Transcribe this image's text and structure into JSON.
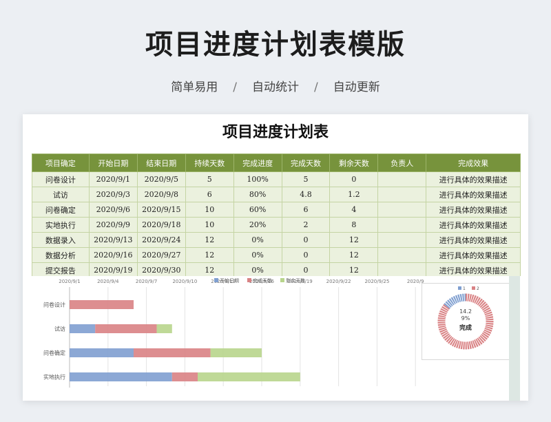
{
  "page": {
    "title": "项目进度计划表模版",
    "subtitle": [
      "简单易用",
      "/",
      "自动统计",
      "/",
      "自动更新"
    ]
  },
  "sheet": {
    "title": "项目进度计划表",
    "headers": [
      "项目确定",
      "开始日期",
      "结束日期",
      "持续天数",
      "完成进度",
      "完成天数",
      "剩余天数",
      "负责人",
      "完成效果"
    ],
    "rows": [
      [
        "问卷设计",
        "2020/9/1",
        "2020/9/5",
        "5",
        "100%",
        "5",
        "0",
        "",
        "进行具体的效果描述"
      ],
      [
        "试访",
        "2020/9/3",
        "2020/9/8",
        "6",
        "80%",
        "4.8",
        "1.2",
        "",
        "进行具体的效果描述"
      ],
      [
        "问卷确定",
        "2020/9/6",
        "2020/9/15",
        "10",
        "60%",
        "6",
        "4",
        "",
        "进行具体的效果描述"
      ],
      [
        "实地执行",
        "2020/9/9",
        "2020/9/18",
        "10",
        "20%",
        "2",
        "8",
        "",
        "进行具体的效果描述"
      ],
      [
        "数据录入",
        "2020/9/13",
        "2020/9/24",
        "12",
        "0%",
        "0",
        "12",
        "",
        "进行具体的效果描述"
      ],
      [
        "数据分析",
        "2020/9/16",
        "2020/9/27",
        "12",
        "0%",
        "0",
        "12",
        "",
        "进行具体的效果描述"
      ],
      [
        "提交报告",
        "2020/9/19",
        "2020/9/30",
        "12",
        "0%",
        "0",
        "12",
        "",
        "进行具体的效果描述"
      ]
    ]
  },
  "colors": {
    "header_green": "#77933c",
    "row_green": "#ebf1de",
    "series_start": "#7f9fd0",
    "series_done": "#d98284",
    "series_remaining": "#b8d58c"
  },
  "chart_data": [
    {
      "type": "bar",
      "orientation": "horizontal-stacked",
      "x_tick_labels": [
        "2020/9/1",
        "2020/9/4",
        "2020/9/7",
        "2020/9/10",
        "2020/9/13",
        "2020/9/16",
        "2020/9/19",
        "2020/9/22",
        "2020/9/25",
        "2020/9"
      ],
      "xlim_days": [
        0,
        27
      ],
      "categories": [
        "问卷设计",
        "试访",
        "问卷确定",
        "实地执行"
      ],
      "series": [
        {
          "name": "开始日期",
          "values": [
            0,
            2,
            5,
            8
          ]
        },
        {
          "name": "完成天数",
          "values": [
            5,
            4.8,
            6,
            2
          ]
        },
        {
          "name": "剩余天数",
          "values": [
            0,
            1.2,
            4,
            8
          ]
        }
      ],
      "legend": "top",
      "grid": true
    },
    {
      "type": "pie",
      "style": "donut",
      "legend_labels": [
        "1",
        "2"
      ],
      "slices": [
        {
          "name": "1",
          "value": 14.29
        },
        {
          "name": "2",
          "value": 85.71
        }
      ],
      "value_label": "14.2",
      "percent_label": "9%",
      "center_label": "完成"
    }
  ]
}
